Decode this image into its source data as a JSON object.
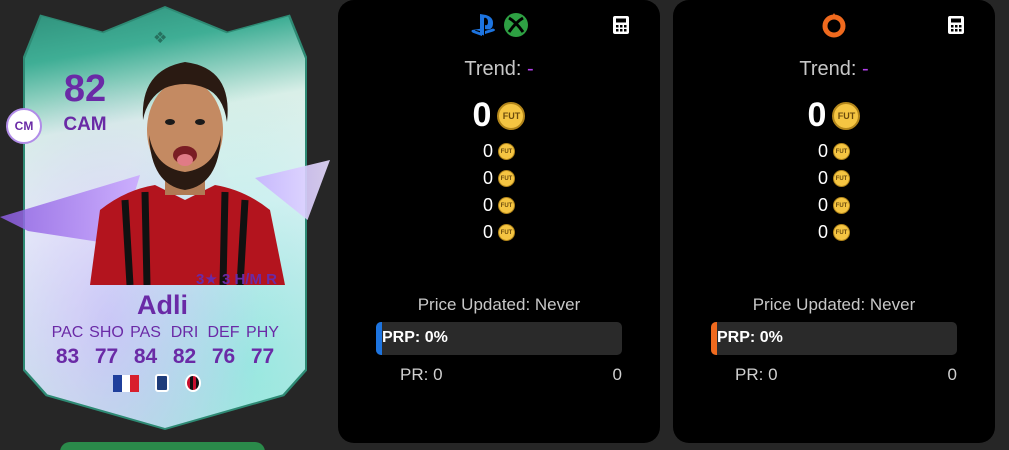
{
  "card": {
    "rating": "82",
    "position": "CAM",
    "alt_position": "CM",
    "skills_weakfoot": "3★ 3 H/M R",
    "name": "Adli",
    "stat_labels": [
      "PAC",
      "SHO",
      "PAS",
      "DRI",
      "DEF",
      "PHY"
    ],
    "stat_values": [
      "83",
      "77",
      "84",
      "82",
      "76",
      "77"
    ],
    "nation": "France",
    "club": "AC Milan"
  },
  "panels": [
    {
      "platform": "console",
      "platform_icons": [
        "playstation-icon",
        "xbox-icon"
      ],
      "accent_color": "#1d74e0",
      "trend_label": "Trend:",
      "trend_value": "-",
      "main_price": "0",
      "other_prices": [
        "0",
        "0",
        "0",
        "0"
      ],
      "coin_label": "FUT",
      "price_updated_label": "Price Updated:",
      "price_updated_value": "Never",
      "prp_label": "PRP:",
      "prp_value": "0%",
      "prp_fraction": 0,
      "pr_label": "PR:",
      "pr_min": "0",
      "pr_max": "0"
    },
    {
      "platform": "pc",
      "platform_icons": [
        "origin-icon"
      ],
      "accent_color": "#f06a1e",
      "trend_label": "Trend:",
      "trend_value": "-",
      "main_price": "0",
      "other_prices": [
        "0",
        "0",
        "0",
        "0"
      ],
      "coin_label": "FUT",
      "price_updated_label": "Price Updated:",
      "price_updated_value": "Never",
      "prp_label": "PRP:",
      "prp_value": "0%",
      "prp_fraction": 0,
      "pr_label": "PR:",
      "pr_min": "0",
      "pr_max": "0"
    }
  ],
  "colors": {
    "background": "#262626",
    "panel": "#000000",
    "card_text": "#6a2aa6",
    "trend_dash": "#b040e8",
    "coin": "#f5c542"
  }
}
